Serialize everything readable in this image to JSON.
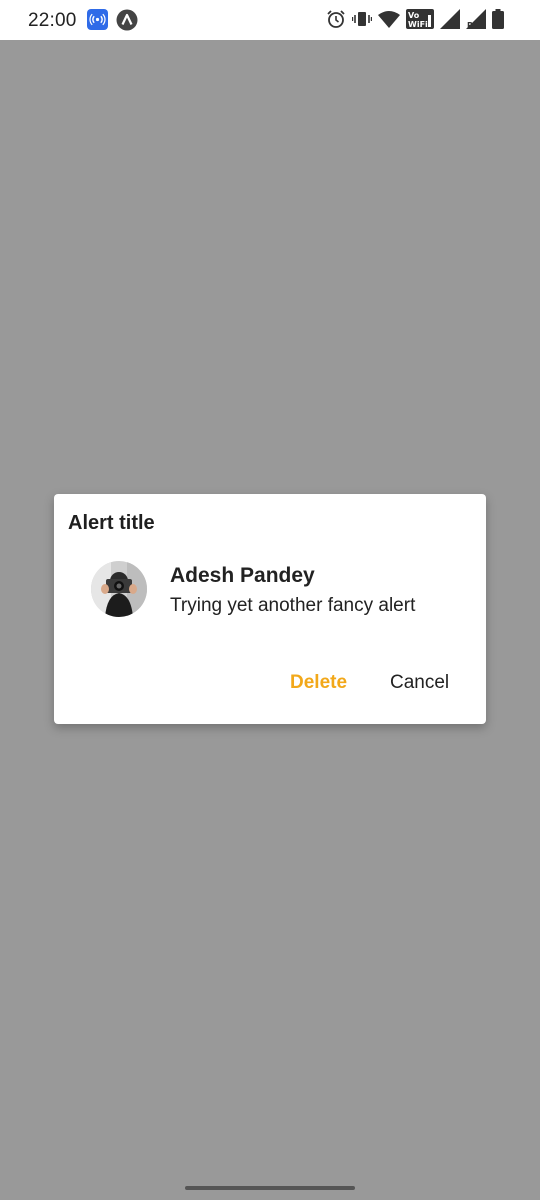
{
  "status_bar": {
    "time": "22:00",
    "icons": [
      "hotspot-icon",
      "app-notification-icon",
      "alarm-icon",
      "vibrate-icon",
      "wifi-icon",
      "vowifi-icon",
      "signal-icon",
      "roaming-signal-icon",
      "battery-icon"
    ],
    "vowifi_label_top": "Vo",
    "vowifi_label_bottom": "WiFi",
    "roaming_label": "R",
    "accent_color": "#2F6BE8"
  },
  "dialog": {
    "title": "Alert title",
    "user_name": "Adesh Pandey",
    "message": "Trying yet another fancy alert",
    "delete_label": "Delete",
    "cancel_label": "Cancel",
    "delete_color": "#F2A81A"
  },
  "background_color": "#999999"
}
